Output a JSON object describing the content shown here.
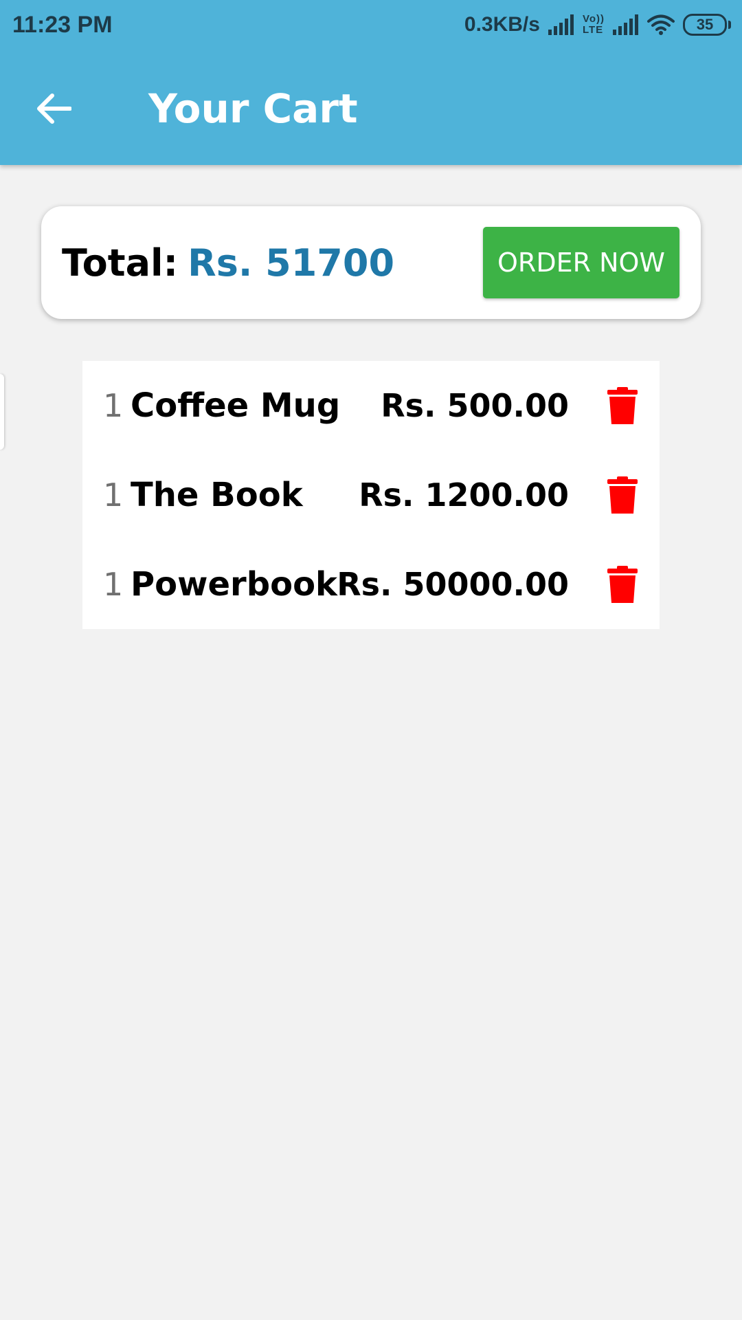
{
  "status_bar": {
    "time": "11:23 PM",
    "network_speed": "0.3KB/s",
    "volte_top": "Vo))",
    "volte_bottom": "LTE",
    "battery": "35"
  },
  "header": {
    "title": "Your Cart",
    "back_icon": "arrow-back-icon"
  },
  "summary": {
    "total_label": "Total:",
    "total_amount": "Rs. 51700",
    "order_button_label": "ORDER NOW"
  },
  "cart": {
    "items": [
      {
        "qty": "1",
        "name": "Coffee Mug",
        "price": "Rs. 500.00"
      },
      {
        "qty": "1",
        "name": "The Book",
        "price": "Rs. 1200.00"
      },
      {
        "qty": "1",
        "name": "Powerbook",
        "price": "Rs. 50000.00"
      }
    ],
    "delete_icon": "trash-icon"
  },
  "colors": {
    "app_bar": "#4fb3d9",
    "background": "#f2f2f2",
    "total_amount": "#1f78a8",
    "order_button": "#3db346",
    "delete_icon": "#ff0000"
  }
}
